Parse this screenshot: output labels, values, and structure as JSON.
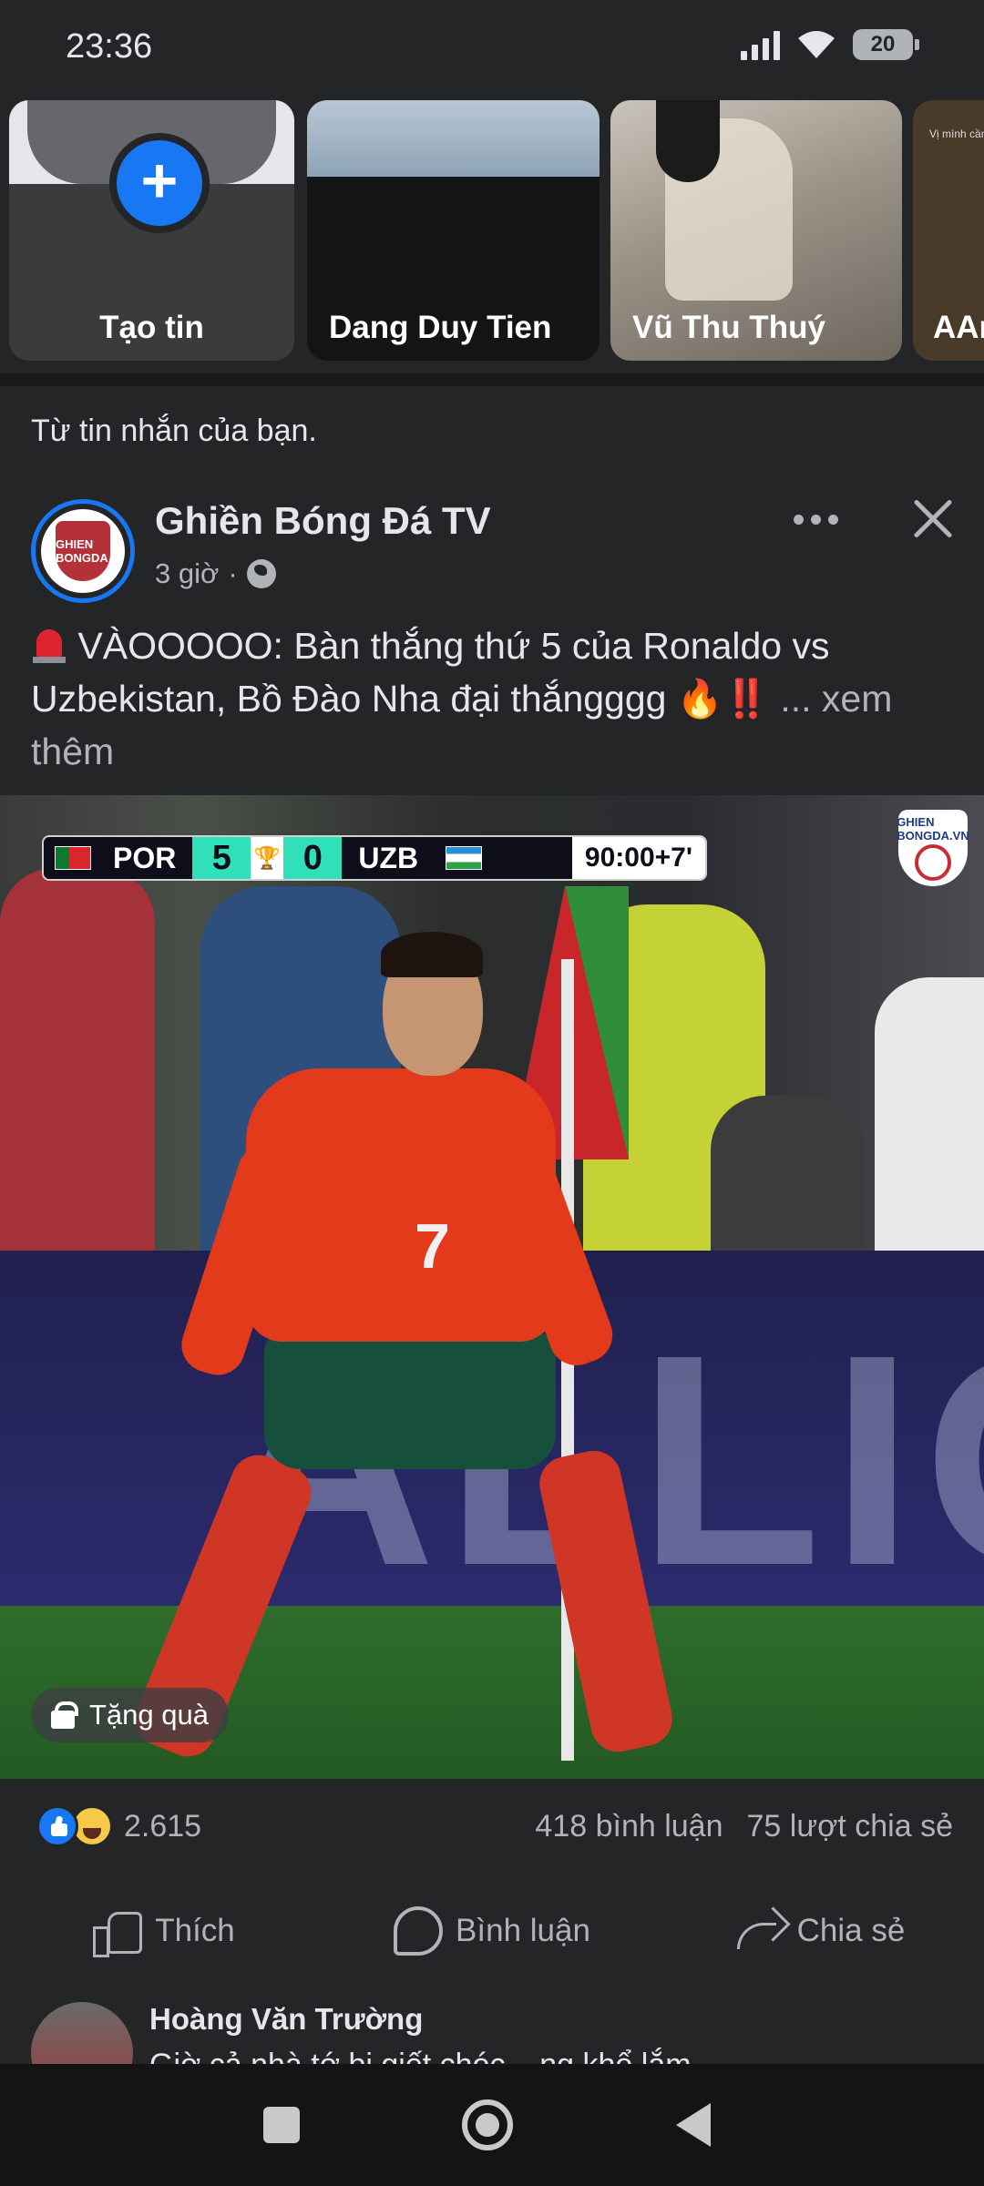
{
  "status_bar": {
    "time": "23:36",
    "battery": "20"
  },
  "stories": [
    {
      "label": "Tạo tin",
      "type": "create"
    },
    {
      "label": "Dang Duy Tien"
    },
    {
      "label": "Vũ Thu Thuý"
    },
    {
      "label": "AAn",
      "caption": "Vị mình cần"
    }
  ],
  "feed_hint": "Từ tin nhắn của bạn.",
  "post": {
    "page_name": "Ghiền Bóng Đá TV",
    "avatar_text": "GHIEN BONGDA",
    "time": "3 giờ",
    "separator": "·",
    "text": " VÀOOOOO: Bàn thắng thứ 5 của Ronaldo vs Uzbekistan, Bồ Đào Nha đại thắngggg 🔥‼️",
    "see_more": "... xem thêm",
    "scorebug": {
      "home": "POR",
      "home_score": "5",
      "away_score": "0",
      "away": "UZB",
      "clock": "90:00+7'"
    },
    "watermark": "GHIEN BONGDA.VN",
    "board_text": "ALLIOO",
    "player_number": "7",
    "gift_label": "Tặng quà",
    "reaction_count": "2.615",
    "comments": "418 bình luận",
    "shares": "75 lượt chia sẻ",
    "actions": {
      "like": "Thích",
      "comment": "Bình luận",
      "share": "Chia sẻ"
    }
  },
  "comment_preview": {
    "name": "Hoàng Văn Trường",
    "snippet": "Giờ cả nhà tớ bị giết chóc ...ng khổ lắm"
  },
  "colors": {
    "accent": "#1877f2",
    "background": "#242526",
    "text": "#e4e6eb",
    "muted": "#b0b3b8"
  }
}
